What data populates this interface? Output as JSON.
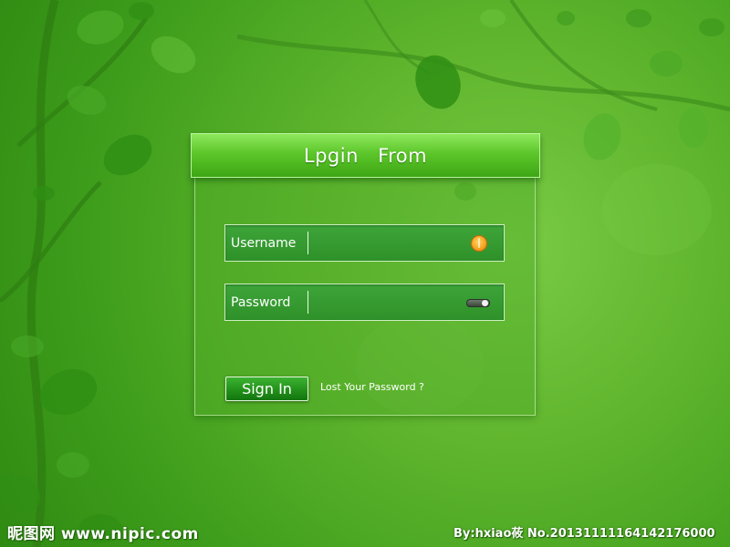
{
  "login": {
    "title": "Lpgin    From",
    "username_label": "Username",
    "username_value": "",
    "username_icon": "orange-icon",
    "password_label": "Password",
    "password_value": "",
    "password_icon": "toggle-icon",
    "sign_in_label": "Sign  In",
    "lost_password_label": "Lost Your Password ?"
  },
  "watermark": {
    "site": "昵图网 www.nipic.com",
    "credit": "By:hxiao莜  No.20131111164142176000"
  },
  "colors": {
    "background": "#5fb52d",
    "title_bar": "#5cc62a",
    "field": "#3ea53a",
    "button": "#23901b",
    "accent_orange": "#f5a623"
  }
}
